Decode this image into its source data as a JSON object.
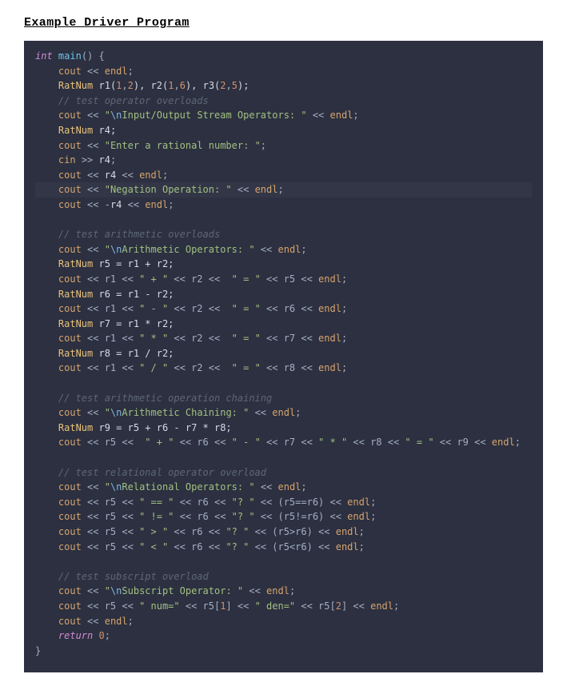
{
  "title": "Example Driver Program",
  "code": {
    "l01a": "int",
    "l01b": " main",
    "l01c": "() {",
    "l02a": "cout",
    "l02b": " << ",
    "l02c": "endl",
    "l02d": ";",
    "l03a": "RatNum",
    "l03b": " r1(",
    "l03c": "1",
    "l03d": ",",
    "l03e": "2",
    "l03f": "), r2(",
    "l03g": "1",
    "l03h": ",",
    "l03i": "6",
    "l03j": "), r3(",
    "l03k": "2",
    "l03l": ",",
    "l03m": "5",
    "l03n": ");",
    "l04": "// test operator overloads",
    "l05a": "cout",
    "l05b": " << ",
    "l05c": "\"",
    "l05n": "\\n",
    "l05d": "Input/Output Stream Operators: ",
    "l05e": "\"",
    "l05f": " << ",
    "l05g": "endl",
    "l05h": ";",
    "l06a": "RatNum",
    "l06b": " r4;",
    "l07a": "cout",
    "l07b": " << ",
    "l07c": "\"Enter a rational number: \"",
    "l07d": ";",
    "l08a": "cin",
    "l08b": " >> ",
    "l08c": "r4",
    "l08d": ";",
    "l09a": "cout",
    "l09b": " << ",
    "l09c": "r4",
    "l09d": " << ",
    "l09e": "endl",
    "l09f": ";",
    "l10a": "cout",
    "l10b": " << ",
    "l10c": "\"Negation Operation: \"",
    "l10d": " << ",
    "l10e": "endl",
    "l10f": ";",
    "l11a": "cout",
    "l11b": " << -",
    "l11c": "r4",
    "l11d": " << ",
    "l11e": "endl",
    "l11f": ";",
    "l12": "// test arithmetic overloads",
    "l13a": "cout",
    "l13b": " << ",
    "l13c": "\"",
    "l13n": "\\n",
    "l13d": "Arithmetic Operators: ",
    "l13e": "\"",
    "l13f": " << ",
    "l13g": "endl",
    "l13h": ";",
    "l14a": "RatNum",
    "l14b": " r5 = r1 + r2;",
    "l15a": "cout",
    "l15b": " << r1 << ",
    "l15c": "\" + \"",
    "l15d": " << r2 <<  ",
    "l15e": "\" = \"",
    "l15f": " << r5 << ",
    "l15g": "endl",
    "l15h": ";",
    "l16a": "RatNum",
    "l16b": " r6 = r1 - r2;",
    "l17a": "cout",
    "l17b": " << r1 << ",
    "l17c": "\" - \"",
    "l17d": " << r2 <<  ",
    "l17e": "\" = \"",
    "l17f": " << r6 << ",
    "l17g": "endl",
    "l17h": ";",
    "l18a": "RatNum",
    "l18b": " r7 = r1 * r2;",
    "l19a": "cout",
    "l19b": " << r1 << ",
    "l19c": "\" * \"",
    "l19d": " << r2 <<  ",
    "l19e": "\" = \"",
    "l19f": " << r7 << ",
    "l19g": "endl",
    "l19h": ";",
    "l20a": "RatNum",
    "l20b": " r8 = r1 / r2;",
    "l21a": "cout",
    "l21b": " << r1 << ",
    "l21c": "\" / \"",
    "l21d": " << r2 <<  ",
    "l21e": "\" = \"",
    "l21f": " << r8 << ",
    "l21g": "endl",
    "l21h": ";",
    "l22": "// test arithmetic operation chaining",
    "l23a": "cout",
    "l23b": " << ",
    "l23c": "\"",
    "l23n": "\\n",
    "l23d": "Arithmetic Chaining: ",
    "l23e": "\"",
    "l23f": " << ",
    "l23g": "endl",
    "l23h": ";",
    "l24a": "RatNum",
    "l24b": " r9 = r5 + r6 - r7 * r8;",
    "l25a": "cout",
    "l25b": " << r5 <<  ",
    "l25c": "\" + \"",
    "l25d": " << r6 << ",
    "l25e": "\" - \"",
    "l25f": " << r7 << ",
    "l25g": "\" * \"",
    "l25h": " << r8 << ",
    "l25i": "\" = \"",
    "l25j": " << r9 << ",
    "l25k": "endl",
    "l25l": ";",
    "l26": "// test relational operator overload",
    "l27a": "cout",
    "l27b": " << ",
    "l27c": "\"",
    "l27n": "\\n",
    "l27d": "Relational Operators: ",
    "l27e": "\"",
    "l27f": " << ",
    "l27g": "endl",
    "l27h": ";",
    "l28a": "cout",
    "l28b": " << r5 << ",
    "l28c": "\" == \"",
    "l28d": " << r6 << ",
    "l28e": "\"? \"",
    "l28f": " << (r5==r6) << ",
    "l28g": "endl",
    "l28h": ";",
    "l29a": "cout",
    "l29b": " << r5 << ",
    "l29c": "\" != \"",
    "l29d": " << r6 << ",
    "l29e": "\"? \"",
    "l29f": " << (r5!=r6) << ",
    "l29g": "endl",
    "l29h": ";",
    "l30a": "cout",
    "l30b": " << r5 << ",
    "l30c": "\" > \"",
    "l30d": " << r6 << ",
    "l30e": "\"? \"",
    "l30f": " << (r5>r6) << ",
    "l30g": "endl",
    "l30h": ";",
    "l31a": "cout",
    "l31b": " << r5 << ",
    "l31c": "\" < \"",
    "l31d": " << r6 << ",
    "l31e": "\"? \"",
    "l31f": " << (r5<r6) << ",
    "l31g": "endl",
    "l31h": ";",
    "l32": "// test subscript overload",
    "l33a": "cout",
    "l33b": " << ",
    "l33c": "\"",
    "l33n": "\\n",
    "l33d": "Subscript Operator: ",
    "l33e": "\"",
    "l33f": " << ",
    "l33g": "endl",
    "l33h": ";",
    "l34a": "cout",
    "l34b": " << r5 << ",
    "l34c": "\" num=\"",
    "l34d": " << r5[",
    "l34e": "1",
    "l34f": "] << ",
    "l34g": "\" den=\"",
    "l34h": " << r5[",
    "l34i": "2",
    "l34j": "] << ",
    "l34k": "endl",
    "l34l": ";",
    "l35a": "cout",
    "l35b": " << ",
    "l35c": "endl",
    "l35d": ";",
    "l36a": "return",
    "l36b": " ",
    "l36c": "0",
    "l36d": ";",
    "l37": "}"
  }
}
